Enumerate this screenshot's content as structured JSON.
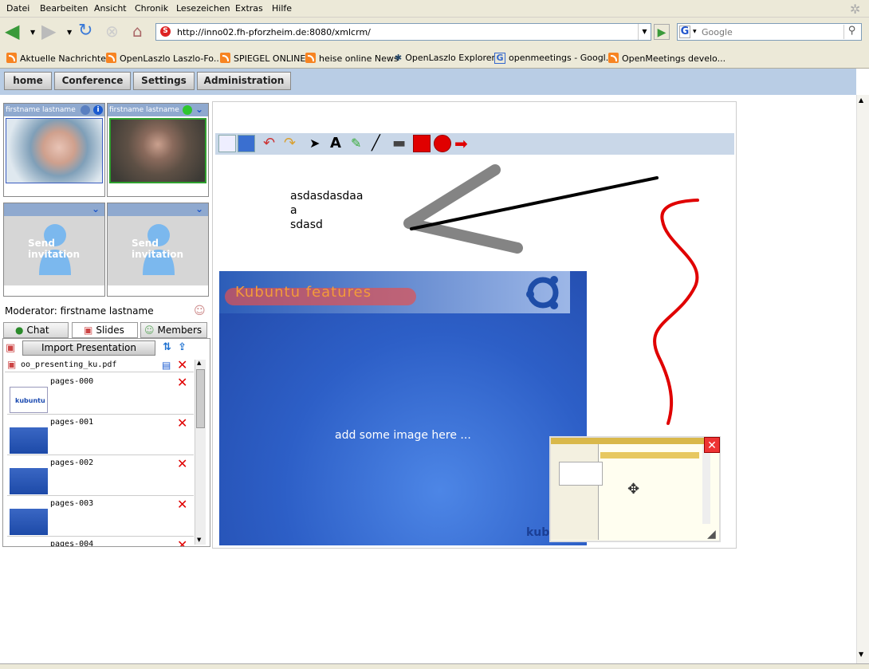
{
  "browser": {
    "menu": [
      "Datei",
      "Bearbeiten",
      "Ansicht",
      "Chronik",
      "Lesezeichen",
      "Extras",
      "Hilfe"
    ],
    "url": "http://inno02.fh-pforzheim.de:8080/xmlcrm/",
    "search_placeholder": "Google",
    "bookmarks": [
      "Aktuelle Nachrichten",
      "OpenLaszlo Laszlo-Fo...",
      "SPIEGEL ONLINE",
      "heise online News",
      "OpenLaszlo Explorer",
      "openmeetings - Googl...",
      "OpenMeetings develo..."
    ]
  },
  "app": {
    "nav": [
      "home",
      "Conference",
      "Settings",
      "Administration"
    ],
    "videos": [
      {
        "name": "firstname lastname"
      },
      {
        "name": "firstname lastname"
      }
    ],
    "invite_label": "Send invitation",
    "moderator": "Moderator: firstname lastname",
    "tabs": [
      "Chat",
      "Slides",
      "Members"
    ],
    "import_label": "Import Presentation",
    "file_name": "oo_presenting_ku.pdf",
    "slides": [
      "pages-000",
      "pages-001",
      "pages-002",
      "pages-003",
      "pages-004"
    ],
    "slide_thumb_label": "kubuntu"
  },
  "whiteboard": {
    "text_lines": [
      "asdasdasdaa",
      "a",
      "sdasd"
    ],
    "slide_title": "Kubuntu features",
    "slide_body": "add some image here ...",
    "slide_footer": "kub"
  },
  "colors": {
    "accent": "#b9cde5",
    "pen_red": "#e00000",
    "slide_blue": "#2d5fc7"
  }
}
